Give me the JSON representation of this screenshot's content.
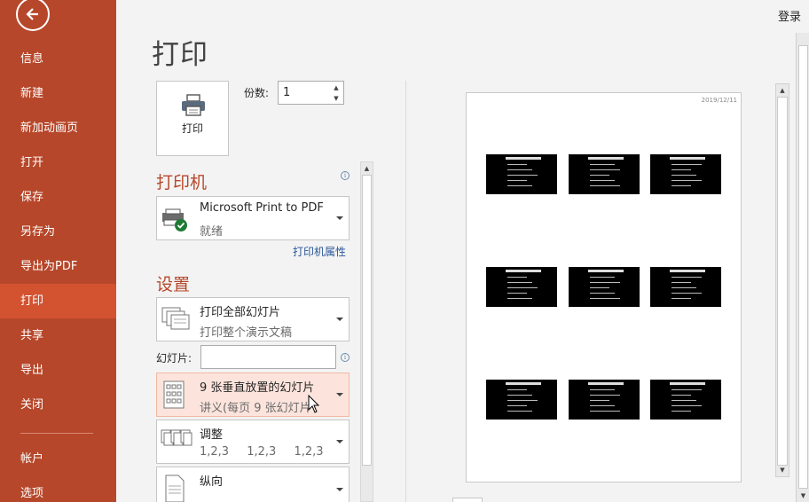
{
  "nav": {
    "items": [
      {
        "label": "信息",
        "active": false
      },
      {
        "label": "新建",
        "active": false
      },
      {
        "label": "新加动画页",
        "active": false
      },
      {
        "label": "打开",
        "active": false
      },
      {
        "label": "保存",
        "active": false
      },
      {
        "label": "另存为",
        "active": false
      },
      {
        "label": "导出为PDF",
        "active": false
      },
      {
        "label": "打印",
        "active": true
      },
      {
        "label": "共享",
        "active": false
      },
      {
        "label": "导出",
        "active": false
      },
      {
        "label": "关闭",
        "active": false
      }
    ],
    "bottom_items": [
      {
        "label": "帐户"
      },
      {
        "label": "选项"
      }
    ],
    "back_icon": "back-arrow-icon",
    "colors": {
      "background": "#b7472a",
      "active": "#d35230"
    }
  },
  "header": {
    "login_label": "登录"
  },
  "page": {
    "title": "打印"
  },
  "print": {
    "button_label": "打印",
    "copies_label": "份数:",
    "copies_value": "1"
  },
  "printer": {
    "heading": "打印机",
    "name": "Microsoft Print to PDF",
    "status": "就绪",
    "properties_link": "打印机属性"
  },
  "settings": {
    "heading": "设置",
    "range": {
      "title": "打印全部幻灯片",
      "subtitle": "打印整个演示文稿"
    },
    "slides_label": "幻灯片:",
    "slides_value": "",
    "layout": {
      "title": "9 张垂直放置的幻灯片",
      "subtitle": "讲义(每页 9 张幻灯片"
    },
    "collate": {
      "title": "调整",
      "values": [
        "1,2,3",
        "1,2,3",
        "1,2,3"
      ]
    },
    "orientation": {
      "title": "纵向"
    }
  },
  "preview": {
    "date": "2019/12/11",
    "slides_per_page": 9
  }
}
